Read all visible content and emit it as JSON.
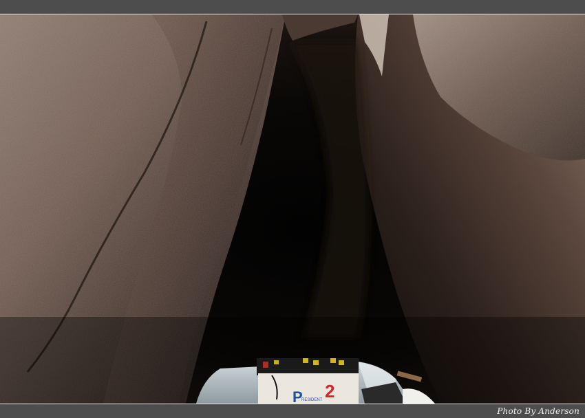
{
  "photo": {
    "subject": "lava-tube-cave-with-boat",
    "battery_brand": "PRESIDENT",
    "battery_number": "2"
  },
  "credit": {
    "text": "Photo By Anderson"
  },
  "colors": {
    "band": "#4d4d4d",
    "rock_light": "#8a7466",
    "rock_dark": "#241a15",
    "void": "#050403",
    "boat": "#b9c4c8"
  }
}
